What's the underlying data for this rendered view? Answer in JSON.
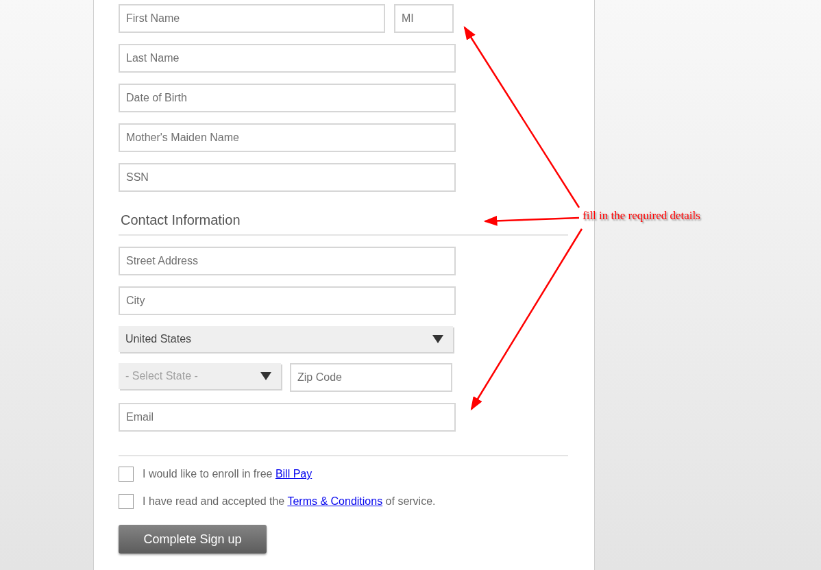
{
  "personal_fields": [
    {
      "kind": "row",
      "items": [
        {
          "kind": "text",
          "placeholder": "First Name"
        },
        {
          "kind": "text",
          "placeholder": "MI"
        }
      ]
    },
    {
      "kind": "text",
      "placeholder": "Last Name"
    },
    {
      "kind": "text",
      "placeholder": "Date of Birth"
    },
    {
      "kind": "text",
      "placeholder": "Mother's Maiden Name"
    },
    {
      "kind": "text",
      "placeholder": "SSN"
    }
  ],
  "contact_section": {
    "title": "Contact Information",
    "fields": [
      {
        "kind": "text",
        "placeholder": "Street Address"
      },
      {
        "kind": "text",
        "placeholder": "City"
      },
      {
        "kind": "select",
        "value": "United States"
      },
      {
        "kind": "row",
        "items": [
          {
            "kind": "select",
            "placeholder": "- Select State -"
          },
          {
            "kind": "text",
            "placeholder": "Zip Code"
          }
        ]
      },
      {
        "kind": "text",
        "placeholder": "Email"
      }
    ]
  },
  "agreements": [
    {
      "checked": false,
      "text_before": "I would like to enroll in free ",
      "link": "Bill Pay"
    },
    {
      "checked": false,
      "text_before": "I have read and accepted the ",
      "link": "Terms & Conditions",
      "text_after": " of service."
    }
  ],
  "submit_button": "Complete Sign up",
  "annotation": {
    "text": "fill in the required details"
  }
}
